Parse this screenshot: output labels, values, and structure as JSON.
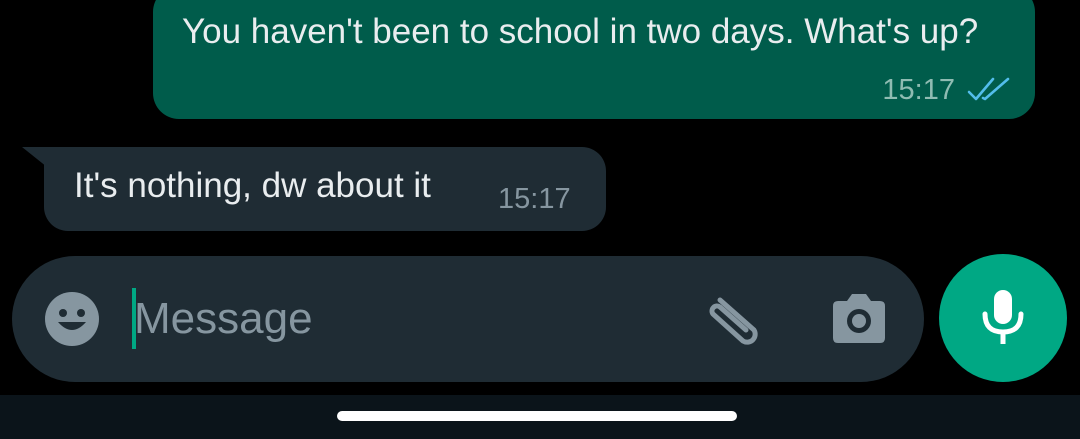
{
  "chat": {
    "messages": [
      {
        "direction": "outgoing",
        "text": "You haven't been to school in two days. What's up?",
        "time": "15:17",
        "status": "read",
        "status_icon": "double-check-icon"
      },
      {
        "direction": "incoming",
        "text": "It's nothing, dw about it",
        "time": "15:17"
      }
    ]
  },
  "composer": {
    "placeholder": "Message",
    "value": "",
    "icons": {
      "emoji": "emoji-icon",
      "attach": "paperclip-icon",
      "camera": "camera-icon",
      "send": "microphone-icon"
    }
  },
  "colors": {
    "background": "#000000",
    "outgoing_bubble": "#005c4b",
    "incoming_bubble": "#1f2c34",
    "composer_background": "#1f2c34",
    "accent": "#00a884",
    "read_ticks": "#53bdeb",
    "icon_gray": "#8696a0",
    "text": "#e9edef"
  }
}
